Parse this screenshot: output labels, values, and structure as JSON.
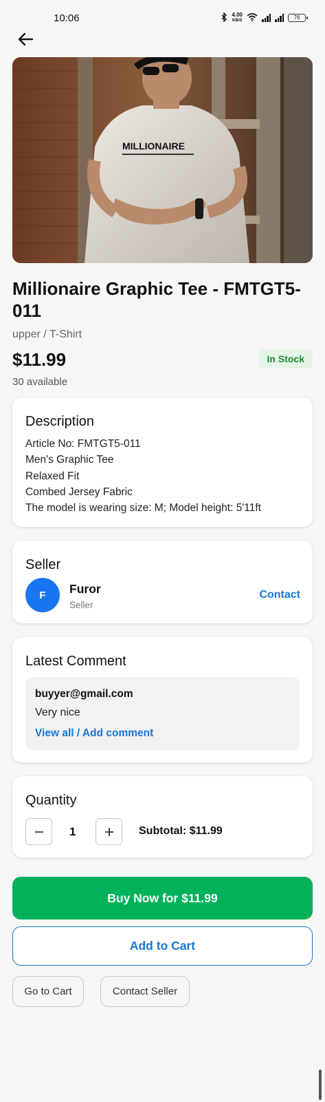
{
  "status_bar": {
    "time": "10:06",
    "net_speed_value": "4.00",
    "net_speed_unit": "KB/S",
    "battery": "76"
  },
  "product": {
    "title": "Millionaire Graphic Tee - FMTGT5-011",
    "category": "upper / T-Shirt",
    "price": "$11.99",
    "stock_status": "In Stock",
    "available": "30 available",
    "shirt_print": "MILLIONAIRE",
    "stock_color": "#1b8a34"
  },
  "description": {
    "title": "Description",
    "lines": [
      "Article No: FMTGT5-011",
      "Men's Graphic Tee",
      "Relaxed Fit",
      "Combed Jersey Fabric",
      "The model is wearing size: M; Model height: 5'11ft"
    ]
  },
  "seller": {
    "title": "Seller",
    "avatar_initial": "F",
    "name": "Furor",
    "role": "Seller",
    "contact_label": "Contact",
    "avatar_color": "#1976f2"
  },
  "comments": {
    "title": "Latest Comment",
    "author": "buyyer@gmail.com",
    "text": "Very nice",
    "link_label": "View all / Add comment"
  },
  "quantity": {
    "title": "Quantity",
    "value": "1",
    "subtotal": "Subtotal: $11.99"
  },
  "actions": {
    "buy_now": "Buy Now for $11.99",
    "add_to_cart": "Add to Cart",
    "go_to_cart": "Go to Cart",
    "contact_seller": "Contact Seller",
    "buy_color": "#00b159",
    "link_color": "#1976d2"
  },
  "icons": {
    "back": "arrow-left-icon",
    "minus": "minus-icon",
    "plus": "plus-icon"
  }
}
